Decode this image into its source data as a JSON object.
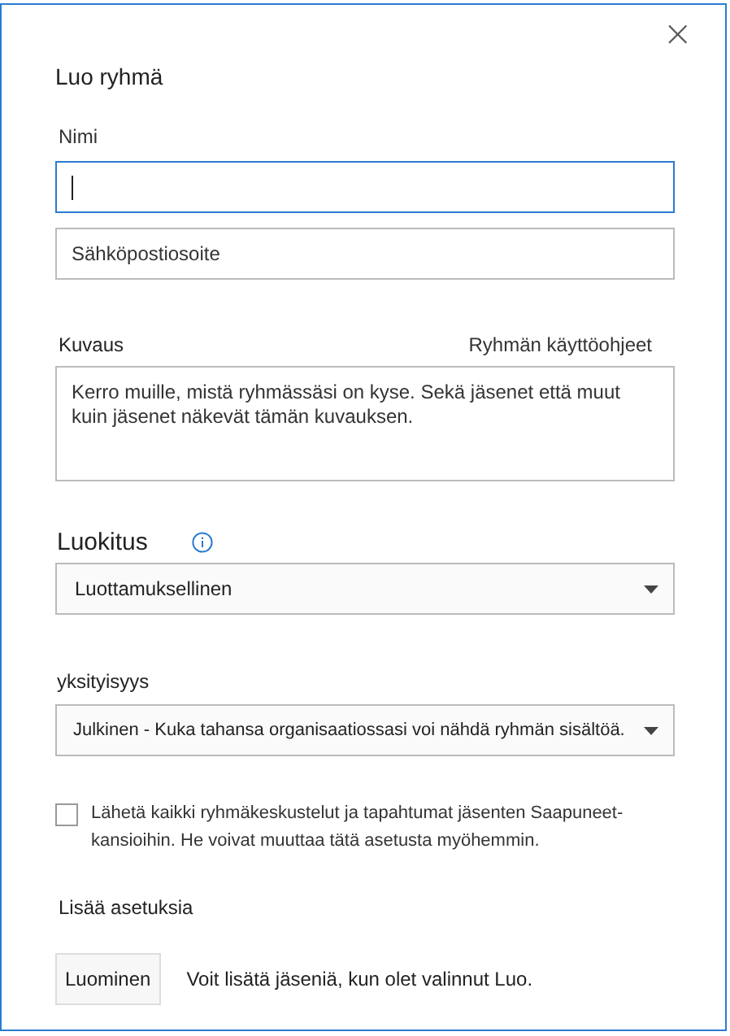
{
  "dialog": {
    "title": "Luo ryhmä",
    "close": "×"
  },
  "name_field": {
    "label": "Nimi",
    "focused": true
  },
  "email_field": {
    "placeholder": "Sähköpostiosoite"
  },
  "description": {
    "label": "Kuvaus",
    "link": "Ryhmän käyttöohjeet",
    "placeholder": "Kerro muille, mistä ryhmässäsi on kyse. Sekä jäsenet että muut kuin jäsenet näkevät tämän kuvauksen."
  },
  "classification": {
    "label": "Luokitus",
    "value": "Luottamuksellinen"
  },
  "privacy": {
    "label": "yksityisyys",
    "value": "Julkinen - Kuka tahansa organisaatiossasi voi nähdä ryhmän sisältöä."
  },
  "subscribe": {
    "checked": false,
    "label": "Lähetä kaikki ryhmäkeskustelut ja tapahtumat jäsenten Saapuneet-kansioihin. He voivat muuttaa tätä asetusta myöhemmin."
  },
  "more_settings": "Lisää asetuksia",
  "create_button": "Luominen",
  "create_hint": "Voit lisätä jäseniä, kun olet valinnut Luo."
}
